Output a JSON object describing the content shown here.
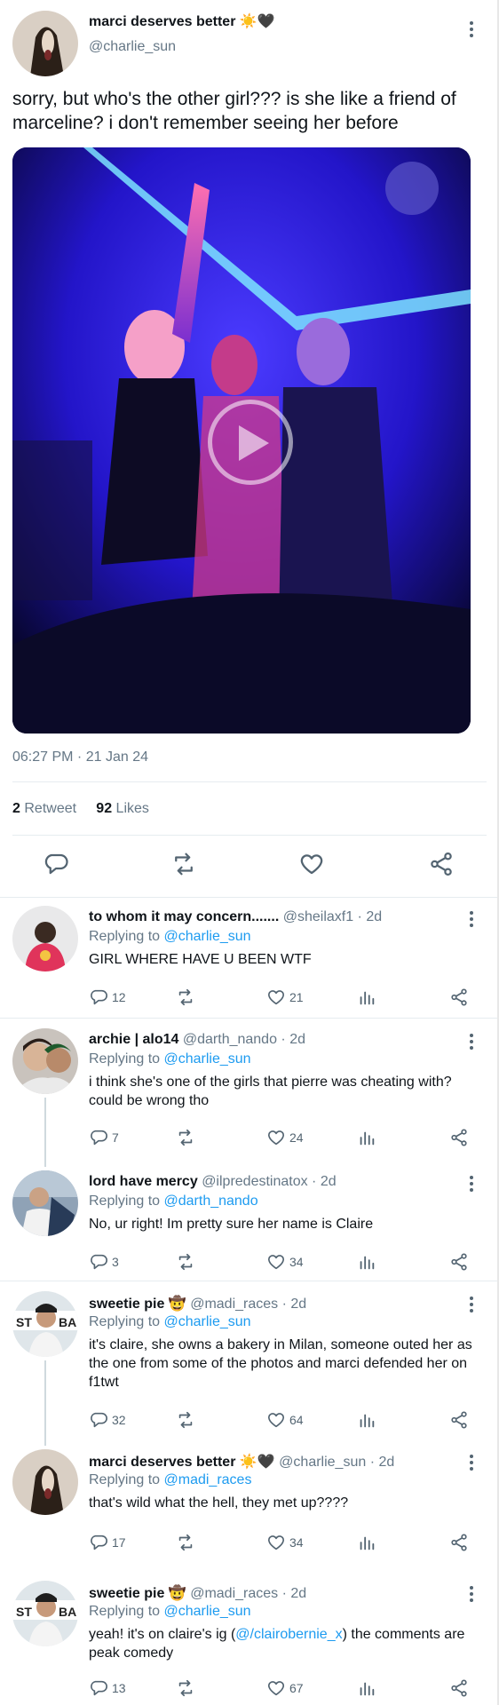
{
  "main": {
    "author": "marci deserves better",
    "author_emojis": "☀️🖤",
    "handle": "@charlie_sun",
    "text": "sorry, but who's the other girl??? is she like a friend of marceline? i don't remember seeing her before",
    "timestamp": "06:27 PM · 21 Jan 24",
    "retweets": "2",
    "retweets_label": "Retweet",
    "likes": "92",
    "likes_label": "Likes"
  },
  "replying_label": "Replying to",
  "replies": [
    {
      "name": "to whom it may concern.......",
      "handle_time": "@sheilaxf1 · 2d",
      "replying_to": "@charlie_sun",
      "text": "GIRL WHERE HAVE U BEEN WTF",
      "replies": "12",
      "likes": "21"
    },
    {
      "name": "archie | alo14",
      "handle_time": "@darth_nando · 2d",
      "replying_to": "@charlie_sun",
      "text": "i think she's one of the girls that pierre was cheating with? could be wrong tho",
      "replies": "7",
      "likes": "24"
    },
    {
      "name": "lord have mercy",
      "handle_time": "@ilpredestinatox · 2d",
      "replying_to": "@darth_nando",
      "text": "No, ur right! Im pretty sure her name is Claire",
      "replies": "3",
      "likes": "34"
    },
    {
      "name": "sweetie pie 🤠",
      "handle_time": "@madi_races · 2d",
      "replying_to": "@charlie_sun",
      "text": "it's claire, she owns a bakery in Milan, someone outed her as the one from some of the photos and marci defended her on f1twt",
      "replies": "32",
      "likes": "64"
    },
    {
      "name": "marci deserves better ☀️🖤",
      "handle_time": "@charlie_sun · 2d",
      "replying_to": "@madi_races",
      "text": "that's wild what the hell, they met up????",
      "replies": "17",
      "likes": "34"
    },
    {
      "name": "sweetie pie 🤠",
      "handle_time": "@madi_races · 2d",
      "replying_to": "@charlie_sun",
      "text_before": "yeah! it's on claire's ig (",
      "text_link": "@/clairobernie_x",
      "text_after": ") the comments are peak comedy",
      "replies": "13",
      "likes": "67"
    }
  ],
  "colors": {
    "link": "#1d9bf0",
    "secondary": "#657786",
    "text": "#0f1419",
    "video_bg": "#0a0a3a",
    "video_glow": "#3b2cff"
  },
  "icons": [
    "more-icon",
    "reply-icon",
    "retweet-icon",
    "like-icon",
    "views-icon",
    "share-icon",
    "play-icon"
  ]
}
